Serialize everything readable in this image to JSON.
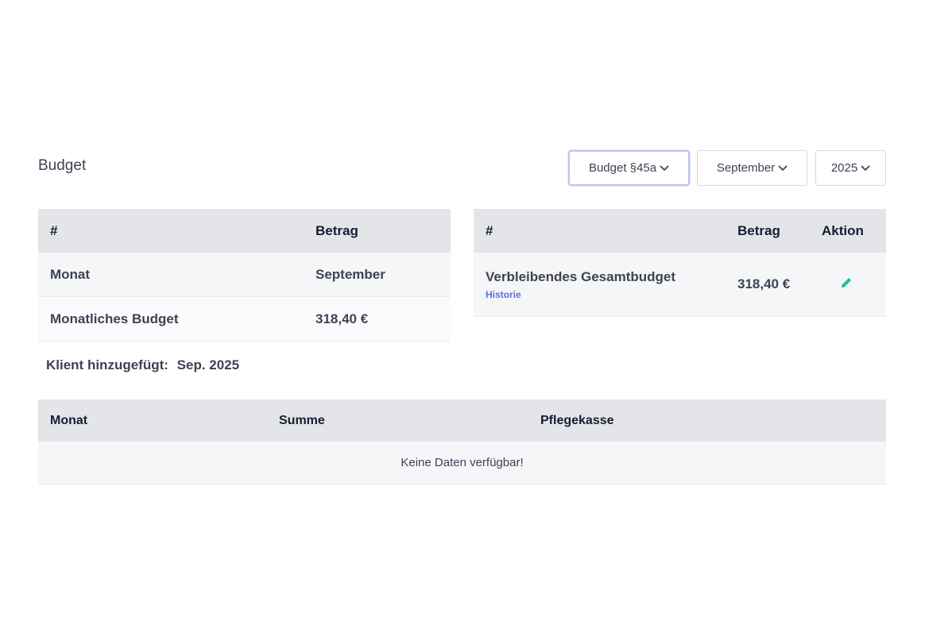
{
  "page": {
    "title": "Budget"
  },
  "filters": {
    "budget_type": "Budget §45a",
    "month": "September",
    "year": "2025"
  },
  "budget_table": {
    "headers": [
      "#",
      "Betrag"
    ],
    "rows": [
      {
        "label": "Monat",
        "value": "September"
      },
      {
        "label": "Monatliches Budget",
        "value": "318,40 €"
      }
    ]
  },
  "remaining_table": {
    "headers": [
      "#",
      "Betrag",
      "Aktion"
    ],
    "row": {
      "label": "Verbleibendes Gesamtbudget",
      "link": "Historie",
      "value": "318,40 €",
      "action_icon": "pencil-icon"
    }
  },
  "client_added": {
    "label": "Klient hinzugefügt:",
    "value": "Sep. 2025"
  },
  "history_table": {
    "headers": [
      "Monat",
      "Summe",
      "Pflegekasse"
    ],
    "empty_message": "Keine Daten verfügbar!"
  },
  "colors": {
    "accent_link": "#5b6ee1",
    "edit_icon": "#1bc5a0",
    "header_bg": "#e4e5e9"
  }
}
